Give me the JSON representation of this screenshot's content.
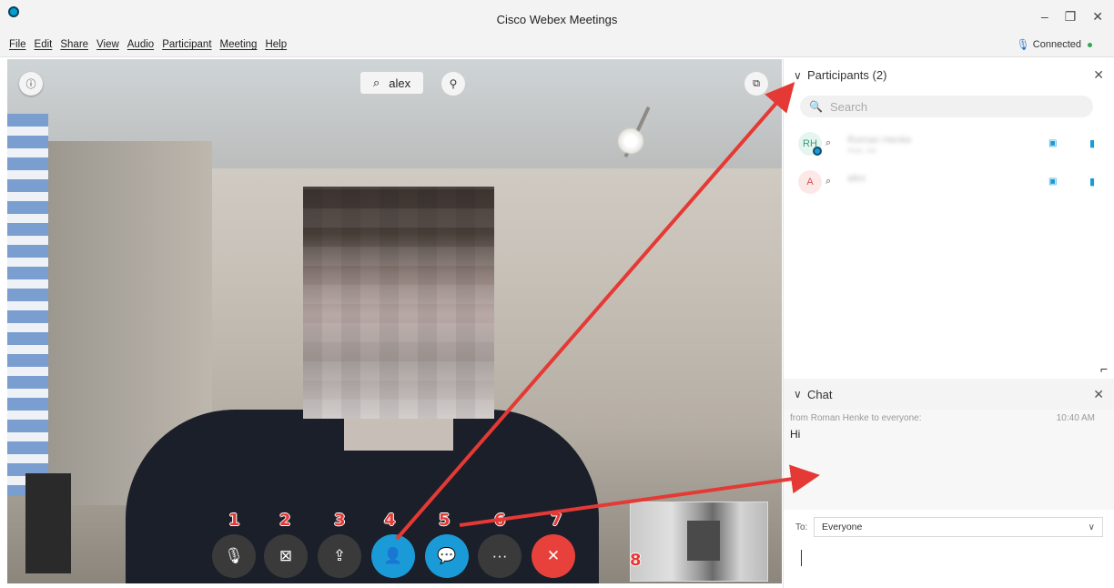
{
  "window": {
    "title": "Cisco Webex Meetings",
    "minimize": "–",
    "restore": "❐",
    "close": "✕"
  },
  "menu": [
    "File",
    "Edit",
    "Share",
    "View",
    "Audio",
    "Participant",
    "Meeting",
    "Help"
  ],
  "status": {
    "mic_icon": "🎙",
    "text": "Connected"
  },
  "video": {
    "speaker_name": "alex",
    "info_icon": "ⓘ",
    "pin_icon": "⚲",
    "layout_icon": "⧉"
  },
  "controls": [
    {
      "num": "1",
      "icon": "🎙̸",
      "name": "mute"
    },
    {
      "num": "2",
      "icon": "⊘",
      "name": "video"
    },
    {
      "num": "3",
      "icon": "⇪",
      "name": "share"
    },
    {
      "num": "4",
      "icon": "👤",
      "name": "participants"
    },
    {
      "num": "5",
      "icon": "💬",
      "name": "chat"
    },
    {
      "num": "6",
      "icon": "···",
      "name": "more"
    },
    {
      "num": "7",
      "icon": "✕",
      "name": "leave"
    }
  ],
  "selfview_num": "8",
  "participants": {
    "header": "Participants (2)",
    "search_placeholder": "Search",
    "list": [
      {
        "initials": "RH",
        "name": "Roman Henke",
        "sub": "Host, me"
      },
      {
        "initials": "A",
        "name": "alex",
        "sub": ""
      }
    ]
  },
  "chat": {
    "header": "Chat",
    "from": "from Roman Henke to everyone:",
    "time": "10:40 AM",
    "message": "Hi",
    "to_label": "To:",
    "to_value": "Everyone"
  },
  "colors": {
    "accent": "#1a9bd7",
    "leave": "#e8413b",
    "annotation": "#e53935"
  }
}
